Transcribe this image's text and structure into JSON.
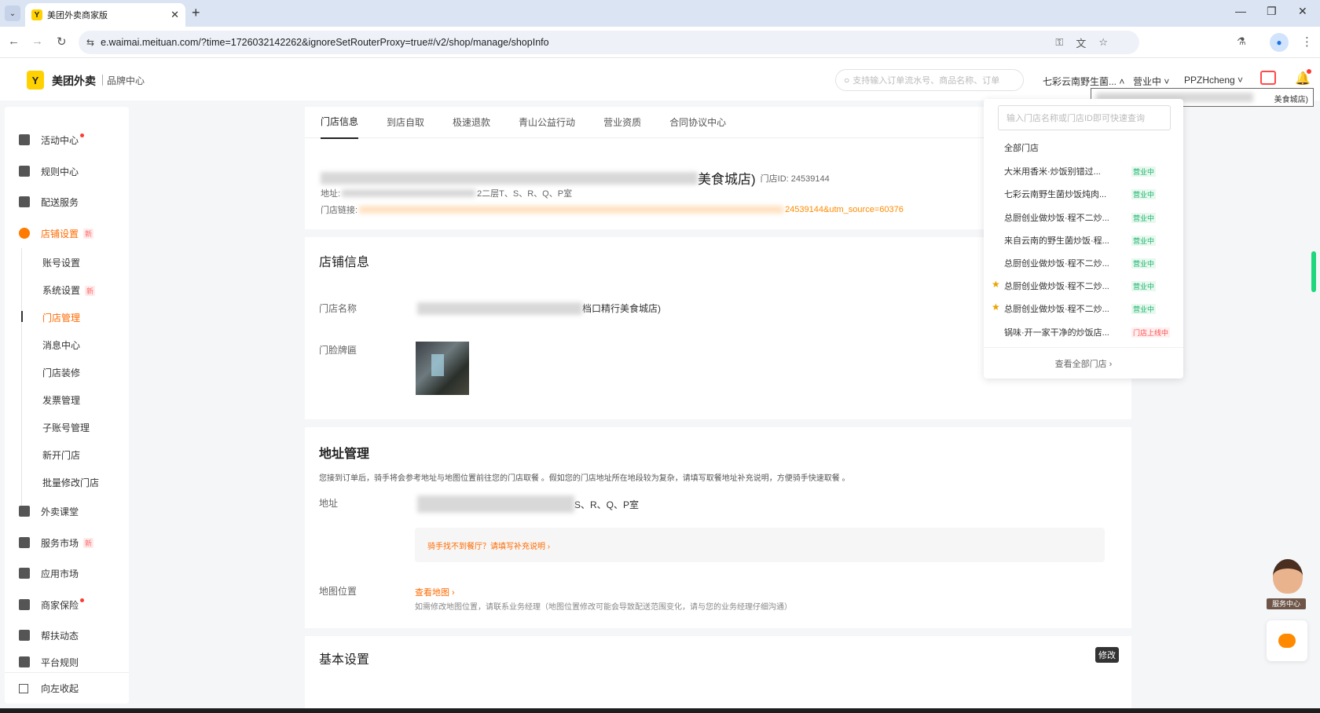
{
  "browser": {
    "tab_title": "美团外卖商家版",
    "url": "e.waimai.meituan.com/?time=1726032142262&ignoreSetRouterProxy=true#/v2/shop/manage/shopInfo"
  },
  "header": {
    "logo_text": "美团外卖",
    "logo_sub": "品牌中心",
    "search_placeholder": "支持输入订单流水号、商品名称、订单",
    "shop_switch": "七彩云南野生菌...",
    "status": "营业中",
    "user": "PPZHcheng",
    "tooltip_tail": "美食城店)"
  },
  "sidebar": {
    "items": [
      {
        "label": "活动中心"
      },
      {
        "label": "规则中心"
      },
      {
        "label": "配送服务"
      },
      {
        "label": "店铺设置",
        "badge": "新"
      },
      {
        "label": "外卖课堂"
      },
      {
        "label": "服务市场",
        "badge": "新"
      },
      {
        "label": "应用市场"
      },
      {
        "label": "商家保险"
      },
      {
        "label": "帮扶动态"
      },
      {
        "label": "平台规则"
      }
    ],
    "sub_items": [
      {
        "label": "账号设置"
      },
      {
        "label": "系统设置",
        "badge": "新"
      },
      {
        "label": "门店管理"
      },
      {
        "label": "消息中心"
      },
      {
        "label": "门店装修"
      },
      {
        "label": "发票管理"
      },
      {
        "label": "子账号管理"
      },
      {
        "label": "新开门店"
      },
      {
        "label": "批量修改门店"
      }
    ],
    "collapse_label": "向左收起"
  },
  "tabs": [
    "门店信息",
    "到店自取",
    "极速退款",
    "青山公益行动",
    "营业资质",
    "合同协议中心"
  ],
  "shop": {
    "title_visible": "美食城店)",
    "id_label": "门店ID:",
    "id": "24539144",
    "address_label": "地址:",
    "address_tail": "2二层T、S、R、Q、P室",
    "link_label": "门店链接:",
    "link_tail": "24539144&utm_source=60376"
  },
  "store_info": {
    "title": "店铺信息",
    "name_label": "门店名称",
    "name_tail": "档口精行美食城店)",
    "photo_label": "门脸牌匾"
  },
  "address_mgmt": {
    "title": "地址管理",
    "hint": "您接到订单后，骑手将会参考地址与地图位置前往您的门店取餐 。假如您的门店地址所在地段较为复杂，请填写取餐地址补充说明，方便骑手快速取餐 。",
    "address_label": "地址",
    "address_tail": "S、R、Q、P室",
    "warn": "骑手找不到餐厅？请填写补充说明  ›",
    "map_label": "地图位置",
    "map_link": "查看地图  ›",
    "map_desc": "如需修改地图位置，请联系业务经理（地图位置修改可能会导致配送范围变化，请与您的业务经理仔细沟通）"
  },
  "basic": {
    "title": "基本设置",
    "edit": "修改"
  },
  "dropdown": {
    "placeholder": "输入门店名称或门店ID即可快速查询",
    "all": "全部门店",
    "stores": [
      {
        "name": "大米用香米·炒饭别错过...",
        "status": "营业中"
      },
      {
        "name": "七彩云南野生菌炒饭炖肉...",
        "status": "营业中"
      },
      {
        "name": "总厨创业做炒饭·程不二炒...",
        "status": "营业中"
      },
      {
        "name": "来自云南的野生菌炒饭·程...",
        "status": "营业中"
      },
      {
        "name": "总厨创业做炒饭·程不二炒...",
        "status": "营业中"
      },
      {
        "name": "总厨创业做炒饭·程不二炒...",
        "status": "营业中"
      },
      {
        "name": "总厨创业做炒饭·程不二炒...",
        "status": "营业中"
      },
      {
        "name": "锅味·开一家干净的炒饭店...",
        "status": "门店上线中"
      }
    ],
    "footer": "查看全部门店 ›"
  },
  "floating": {
    "service_label": "服务中心"
  }
}
